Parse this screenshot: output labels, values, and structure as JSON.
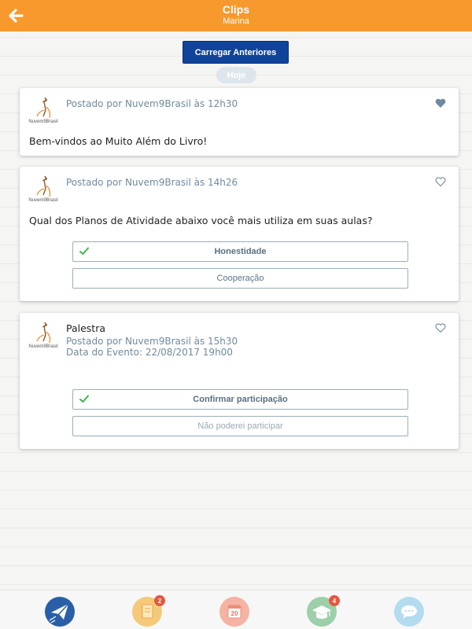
{
  "header": {
    "title": "Clips",
    "subtitle": "Marina"
  },
  "load_more_label": "Carregar Anteriores",
  "date_separator": "Hoje",
  "posts": [
    {
      "meta": "Postado por Nuvem9Brasil às 12h30",
      "text": "Bem-vindos ao Muito Além do Livro!",
      "liked": true
    },
    {
      "meta": "Postado por Nuvem9Brasil às 14h26",
      "text": "Qual dos Planos de Atividade abaixo você mais utiliza em suas aulas?",
      "liked": false,
      "options": [
        {
          "label": "Honestidade",
          "selected": true
        },
        {
          "label": "Cooperação",
          "selected": false
        }
      ]
    },
    {
      "title": "Palestra",
      "meta": "Postado por Nuvem9Brasil às 15h30",
      "event_date": "Data do Evento: 22/08/2017 19h00",
      "liked": false,
      "options": [
        {
          "label": "Confirmar participação",
          "selected": true
        },
        {
          "label": "Não poderei participar",
          "selected": false
        }
      ]
    }
  ],
  "logo_text": "Nuvem9Brasil",
  "tabbar": {
    "tabs": [
      {
        "icon": "paper-plane-icon",
        "color": "#2a5fa8",
        "active": true
      },
      {
        "icon": "notebook-icon",
        "color": "#f5c97a",
        "badge": "2"
      },
      {
        "icon": "calendar-icon",
        "color": "#f4b3a3",
        "calendar_day": "20"
      },
      {
        "icon": "graduation-cap-icon",
        "color": "#9ccfaa",
        "badge": "4"
      },
      {
        "icon": "chat-icon",
        "color": "#b3dcef"
      }
    ]
  },
  "colors": {
    "header": "#f7992c",
    "primary_button": "#10449a",
    "badge": "#e8563f",
    "check": "#3fb650"
  }
}
